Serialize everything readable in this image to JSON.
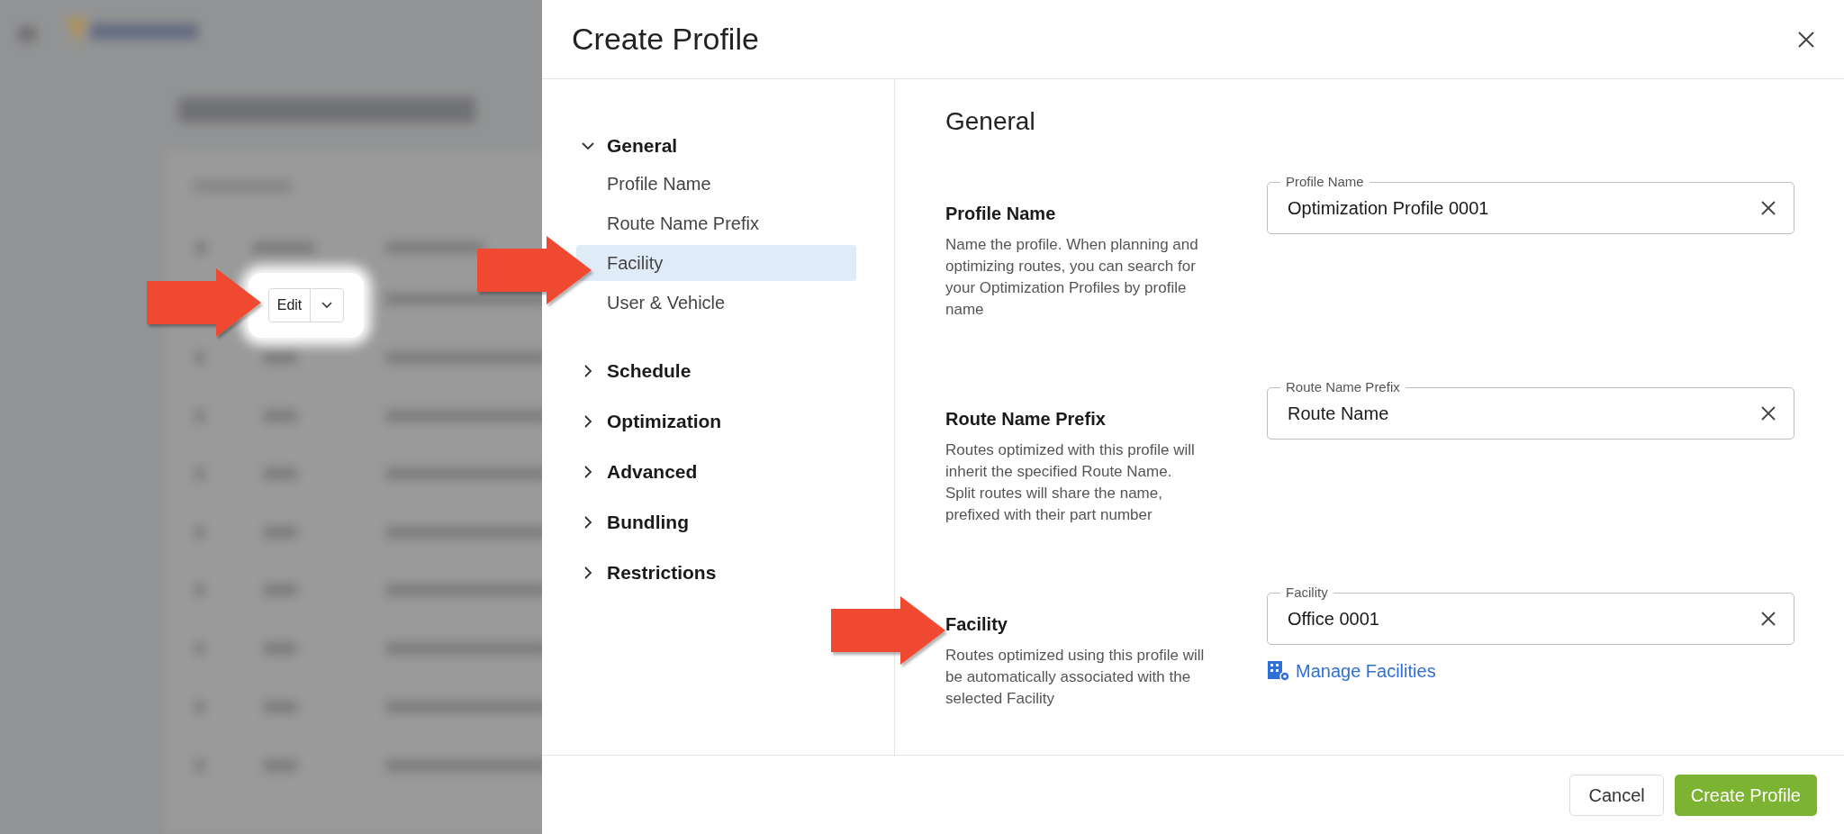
{
  "background": {
    "edit_button": {
      "label": "Edit"
    }
  },
  "dialog": {
    "title": "Create Profile",
    "nav": [
      {
        "label": "General",
        "expanded": true,
        "children": [
          {
            "label": "Profile Name",
            "selected": false
          },
          {
            "label": "Route Name Prefix",
            "selected": false
          },
          {
            "label": "Facility",
            "selected": true
          },
          {
            "label": "User & Vehicle",
            "selected": false
          }
        ]
      },
      {
        "label": "Schedule",
        "expanded": false
      },
      {
        "label": "Optimization",
        "expanded": false
      },
      {
        "label": "Advanced",
        "expanded": false
      },
      {
        "label": "Bundling",
        "expanded": false
      },
      {
        "label": "Restrictions",
        "expanded": false
      }
    ],
    "section_title": "General",
    "fields": [
      {
        "title": "Profile Name",
        "description": "Name the profile. When planning and optimizing routes, you can search for your Optimization Profiles by profile name",
        "label": "Profile Name",
        "value": "Optimization Profile 0001"
      },
      {
        "title": "Route Name Prefix",
        "description": "Routes optimized with this profile will inherit the specified Route Name. Split routes will share the name, prefixed with their part number",
        "label": "Route Name Prefix",
        "value": "Route Name"
      },
      {
        "title": "Facility",
        "description": "Routes optimized using this profile will be automatically associated with the selected Facility",
        "label": "Facility",
        "value": "Office 0001",
        "link": "Manage Facilities"
      }
    ],
    "buttons": [
      {
        "label": "Cancel",
        "kind": "secondary"
      },
      {
        "label": "Create Profile",
        "kind": "primary"
      }
    ]
  }
}
